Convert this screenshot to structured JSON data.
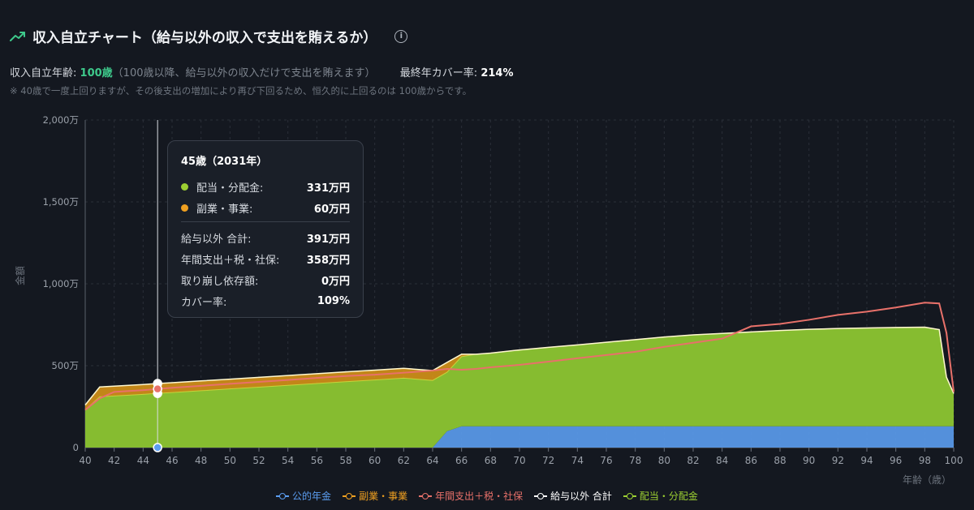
{
  "header": {
    "title": "収入自立チャート（給与以外の収入で支出を賄えるか）",
    "info_icon": "info-icon"
  },
  "stats": {
    "age_label": "収入自立年齢:",
    "age_value": "100歳",
    "age_note": "（100歳以降、給与以外の収入だけで支出を賄えます）",
    "coverage_label": "最終年カバー率:",
    "coverage_value": "214%"
  },
  "note": "※ 40歳で一度上回りますが、その後支出の増加により再び下回るため、恒久的に上回るのは 100歳からです。",
  "tooltip": {
    "title": "45歳（2031年）",
    "rows": [
      {
        "label": "配当・分配金:",
        "value": "331万円",
        "color": "#9ccf32"
      },
      {
        "label": "副業・事業:",
        "value": "60万円",
        "color": "#f0a020"
      }
    ],
    "summary": [
      {
        "label": "給与以外 合計:",
        "value": "391万円"
      },
      {
        "label": "年間支出＋税・社保:",
        "value": "358万円"
      },
      {
        "label": "取り崩し依存額:",
        "value": "0万円"
      },
      {
        "label": "カバー率:",
        "value": "109%"
      }
    ]
  },
  "legend": [
    {
      "label": "公的年金",
      "color": "#5b9df0"
    },
    {
      "label": "副業・事業",
      "color": "#f0a020"
    },
    {
      "label": "年間支出＋税・社保",
      "color": "#e8716a"
    },
    {
      "label": "給与以外 合計",
      "color": "#ffffff"
    },
    {
      "label": "配当・分配金",
      "color": "#9ccf32"
    }
  ],
  "chart_data": {
    "type": "area",
    "xlabel": "年齢（歳）",
    "ylabel": "金額",
    "x_ticks": [
      "40",
      "42",
      "44",
      "46",
      "48",
      "50",
      "52",
      "54",
      "56",
      "58",
      "60",
      "62",
      "64",
      "66",
      "68",
      "70",
      "72",
      "74",
      "76",
      "78",
      "80",
      "82",
      "84",
      "86",
      "88",
      "90",
      "92",
      "94",
      "96",
      "98",
      "100"
    ],
    "y_ticks": [
      "0",
      "500万",
      "1,000万",
      "1,500万",
      "2,000万"
    ],
    "xlim": [
      40,
      100
    ],
    "ylim": [
      0,
      2000
    ],
    "hover_age": 45,
    "grid": true,
    "legend_position": "bottom",
    "x": [
      40,
      41,
      42,
      43,
      44,
      45,
      46,
      48,
      50,
      52,
      54,
      56,
      58,
      60,
      62,
      64,
      65,
      66,
      67,
      68,
      70,
      72,
      74,
      76,
      78,
      80,
      82,
      84,
      86,
      88,
      90,
      92,
      94,
      96,
      98,
      99,
      99.5,
      100
    ],
    "series": [
      {
        "name": "公的年金",
        "color": "#5b9df0",
        "values": [
          0,
          0,
          0,
          0,
          0,
          0,
          0,
          0,
          0,
          0,
          0,
          0,
          0,
          0,
          0,
          0,
          100,
          130,
          130,
          130,
          130,
          130,
          130,
          130,
          130,
          130,
          130,
          130,
          130,
          130,
          130,
          130,
          130,
          130,
          130,
          130,
          130,
          130
        ]
      },
      {
        "name": "配当・分配金",
        "color": "#9ccf32",
        "values": [
          230,
          310,
          315,
          320,
          325,
          331,
          336,
          347,
          358,
          369,
          380,
          391,
          402,
          413,
          424,
          410,
          360,
          425,
          440,
          447,
          466,
          482,
          497,
          513,
          529,
          545,
          558,
          567,
          576,
          585,
          592,
          597,
          600,
          603,
          605,
          590,
          300,
          200
        ]
      },
      {
        "name": "副業・事業",
        "color": "#f0a020",
        "values": [
          30,
          60,
          60,
          60,
          60,
          60,
          60,
          60,
          60,
          60,
          60,
          60,
          60,
          60,
          60,
          60,
          60,
          15,
          0,
          0,
          0,
          0,
          0,
          0,
          0,
          0,
          0,
          0,
          0,
          0,
          0,
          0,
          0,
          0,
          0,
          0,
          0,
          0
        ]
      },
      {
        "name": "年間支出＋税・社保",
        "color": "#e8716a",
        "values": [
          230,
          300,
          340,
          345,
          350,
          358,
          365,
          377,
          389,
          401,
          413,
          425,
          437,
          445,
          457,
          470,
          480,
          475,
          480,
          490,
          505,
          525,
          545,
          565,
          585,
          615,
          640,
          665,
          740,
          755,
          780,
          810,
          830,
          855,
          885,
          880,
          700,
          340
        ]
      }
    ]
  }
}
